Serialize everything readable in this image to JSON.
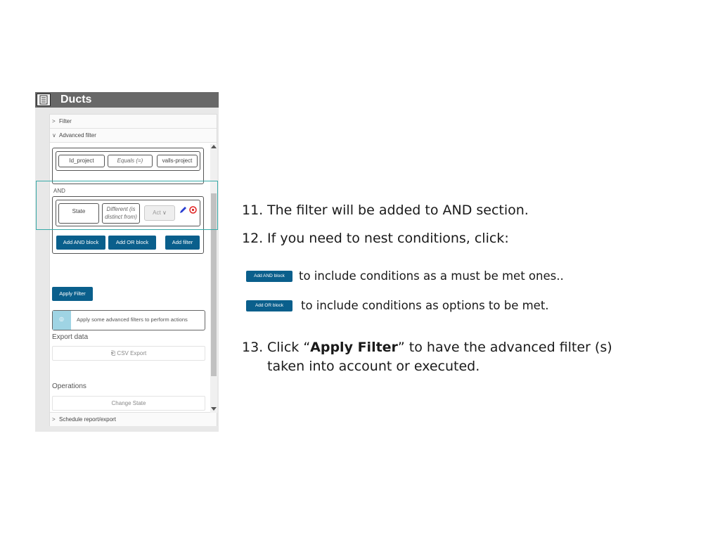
{
  "panel": {
    "title": "Ducts",
    "accordions": {
      "filter": "Filter",
      "advanced_filter": "Advanced filter",
      "schedule": "Schedule report/export"
    },
    "condition1": {
      "field": "Id_project",
      "operator": "Equals (=)",
      "value": "valls-project"
    },
    "and_label": "AND",
    "condition2": {
      "field": "State",
      "operator_line1": "Different (is",
      "operator_line2": "distinct from)",
      "value": "Act"
    },
    "buttons": {
      "add_and_block": "Add AND block",
      "add_or_block": "Add OR block",
      "add_filter": "Add filter",
      "apply_filter": "Apply Filter"
    },
    "info_message": "Apply some advanced filters to perform actions",
    "export_label": "Export data",
    "csv_export": "CSV Export",
    "operations_label": "Operations",
    "change_state": "Change State",
    "colors": {
      "header_bg": "#686868",
      "button_blue": "#0a5f8c",
      "highlight": "#38aaa8",
      "info_bg": "#9fd4e4"
    }
  },
  "instructions": {
    "step11_num": "11.",
    "step11_text": "The filter will be added to AND section.",
    "step12_num": "12.",
    "step12_text": "If you need to nest conditions, click:",
    "and_button_label": "Add AND block",
    "and_note": "to include conditions as a must be met ones..",
    "or_button_label": "Add OR block",
    "or_note": "to include conditions as options to be met.",
    "step13_num": "13.",
    "step13_pre": "Click “",
    "step13_bold": "Apply Filter",
    "step13_post": "” to have the advanced filter (s)",
    "step13_line2": "taken into account or executed."
  }
}
